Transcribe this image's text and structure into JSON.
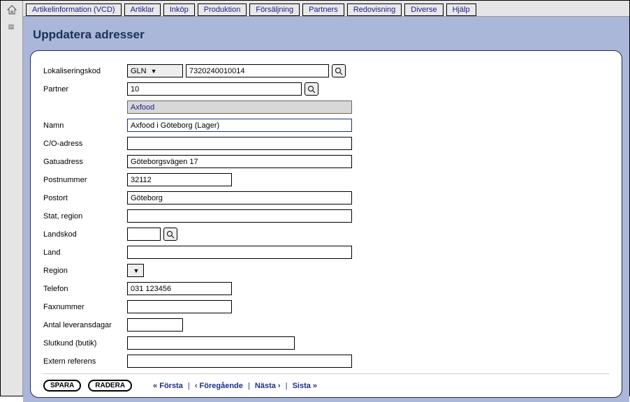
{
  "topbar": {
    "buttons": [
      "Artikelinformation (VCD)",
      "Artiklar",
      "Inköp",
      "Produktion",
      "Försäljning",
      "Partners",
      "Redovisning",
      "Diverse",
      "Hjälp"
    ]
  },
  "title": "Uppdatera adresser",
  "form": {
    "lokaliseringskod": {
      "label": "Lokaliseringskod",
      "select_value": "GLN",
      "value": "7320240010014"
    },
    "partner": {
      "label": "Partner",
      "value": "10",
      "display": "Axfood"
    },
    "namn": {
      "label": "Namn",
      "value": "Axfood i Göteborg (Lager)"
    },
    "co_adress": {
      "label": "C/O-adress",
      "value": ""
    },
    "gatuadress": {
      "label": "Gatuadress",
      "value": "Göteborgsvägen 17"
    },
    "postnummer": {
      "label": "Postnummer",
      "value": "32112"
    },
    "postort": {
      "label": "Postort",
      "value": "Göteborg"
    },
    "stat_region": {
      "label": "Stat, region",
      "value": ""
    },
    "landskod": {
      "label": "Landskod",
      "value": ""
    },
    "land": {
      "label": "Land",
      "value": ""
    },
    "region": {
      "label": "Region",
      "select_value": ""
    },
    "telefon": {
      "label": "Telefon",
      "value": "031 123456"
    },
    "faxnummer": {
      "label": "Faxnummer",
      "value": ""
    },
    "antal_lev": {
      "label": "Antal leveransdagar",
      "value": ""
    },
    "slutkund": {
      "label": "Slutkund (butik)",
      "value": ""
    },
    "extern_ref": {
      "label": "Extern referens",
      "value": ""
    }
  },
  "footer": {
    "save": "SPARA",
    "delete": "RADERA",
    "first": "« Första",
    "prev": "‹ Föregående",
    "next": "Nästa ›",
    "last": "Sista »",
    "sep": "|"
  }
}
